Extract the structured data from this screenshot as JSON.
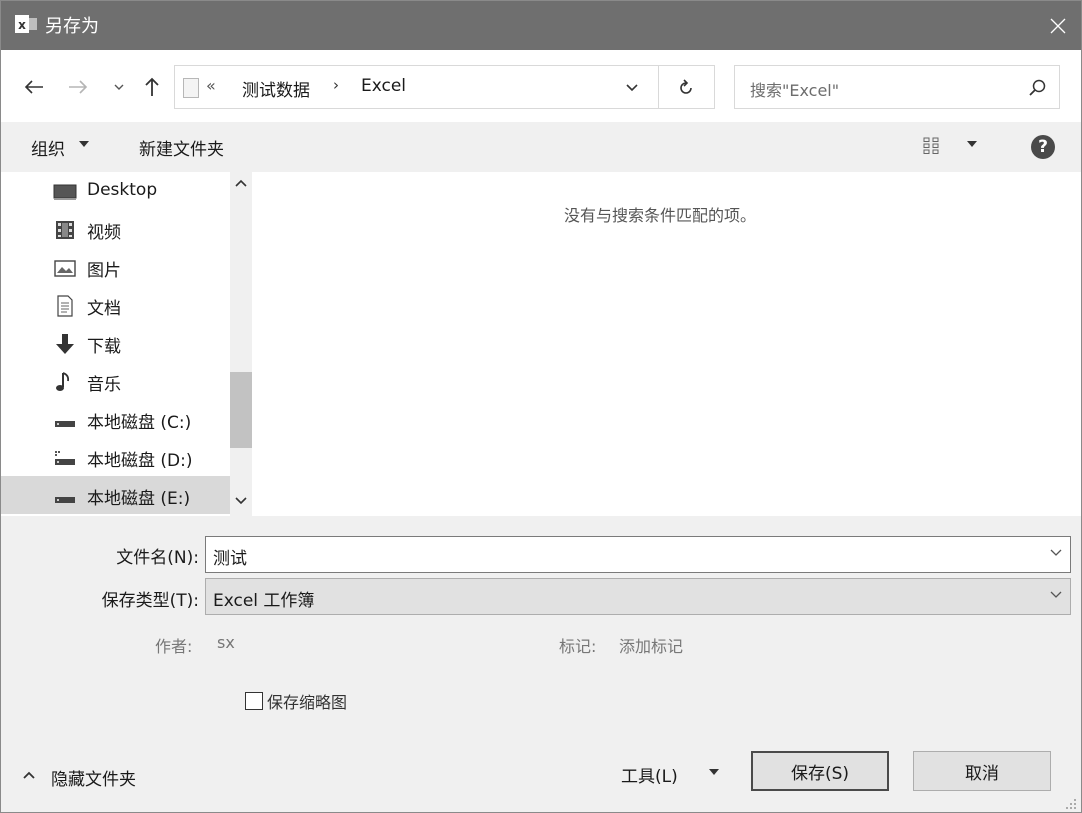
{
  "titlebar": {
    "title": "另存为",
    "app_icon_text": "x"
  },
  "address": {
    "overflow_chevron": "«",
    "crumbs": [
      "测试数据",
      "Excel"
    ],
    "separator": "›"
  },
  "search": {
    "placeholder": "搜索\"Excel\""
  },
  "toolbar": {
    "organize_label": "组织",
    "new_folder_label": "新建文件夹"
  },
  "sidebar": {
    "items": [
      {
        "label": "Desktop",
        "icon": "desktop-icon"
      },
      {
        "label": "视频",
        "icon": "video-icon"
      },
      {
        "label": "图片",
        "icon": "pictures-icon"
      },
      {
        "label": "文档",
        "icon": "documents-icon"
      },
      {
        "label": "下载",
        "icon": "download-icon"
      },
      {
        "label": "音乐",
        "icon": "music-icon"
      },
      {
        "label": "本地磁盘 (C:)",
        "icon": "drive-icon"
      },
      {
        "label": "本地磁盘 (D:)",
        "icon": "drive-icon"
      },
      {
        "label": "本地磁盘 (E:)",
        "icon": "drive-icon",
        "selected": true
      }
    ]
  },
  "content": {
    "empty_message": "没有与搜索条件匹配的项。"
  },
  "form": {
    "filename_label": "文件名(N):",
    "filename_value": "测试",
    "filetype_label": "保存类型(T):",
    "filetype_value": "Excel 工作簿",
    "author_label": "作者:",
    "author_value": "sx",
    "tags_label": "标记:",
    "tags_value": "添加标记",
    "thumbnail_label": "保存缩略图",
    "thumbnail_checked": false
  },
  "footer": {
    "hide_folders_label": "隐藏文件夹",
    "tools_label": "工具(L)",
    "save_label": "保存(S)",
    "cancel_label": "取消"
  },
  "colors": {
    "titlebar": "#6f6f6f",
    "selection": "#d9d9d9",
    "button_face": "#e1e1e1"
  }
}
